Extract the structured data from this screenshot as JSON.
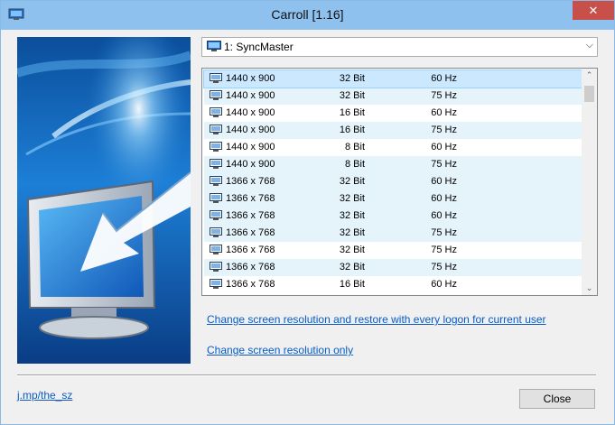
{
  "window": {
    "title": "Carroll [1.16]",
    "close_glyph": "✕"
  },
  "display_select": {
    "value": "1: SyncMaster",
    "icon": "monitor-icon",
    "chevron": "⌵"
  },
  "modes": {
    "rows": [
      {
        "resolution": "1440 x 900",
        "bits": "32 Bit",
        "hz": "60 Hz"
      },
      {
        "resolution": "1440 x 900",
        "bits": "32 Bit",
        "hz": "75 Hz"
      },
      {
        "resolution": "1440 x 900",
        "bits": "16 Bit",
        "hz": "60 Hz"
      },
      {
        "resolution": "1440 x 900",
        "bits": "16 Bit",
        "hz": "75 Hz"
      },
      {
        "resolution": "1440 x 900",
        "bits": "8 Bit",
        "hz": "60 Hz"
      },
      {
        "resolution": "1440 x 900",
        "bits": "8 Bit",
        "hz": "75 Hz"
      },
      {
        "resolution": "1366 x 768",
        "bits": "32 Bit",
        "hz": "60 Hz"
      },
      {
        "resolution": "1366 x 768",
        "bits": "32 Bit",
        "hz": "60 Hz"
      },
      {
        "resolution": "1366 x 768",
        "bits": "32 Bit",
        "hz": "60 Hz"
      },
      {
        "resolution": "1366 x 768",
        "bits": "32 Bit",
        "hz": "75 Hz"
      },
      {
        "resolution": "1366 x 768",
        "bits": "32 Bit",
        "hz": "75 Hz"
      },
      {
        "resolution": "1366 x 768",
        "bits": "32 Bit",
        "hz": "75 Hz"
      },
      {
        "resolution": "1366 x 768",
        "bits": "16 Bit",
        "hz": "60 Hz"
      }
    ],
    "scroll_up": "⌃",
    "scroll_down": "⌄"
  },
  "links": {
    "restore": "Change screen resolution and restore with every logon for current user",
    "only": "Change screen resolution only"
  },
  "footer": {
    "link": "j.mp/the_sz",
    "close_label": "Close"
  }
}
